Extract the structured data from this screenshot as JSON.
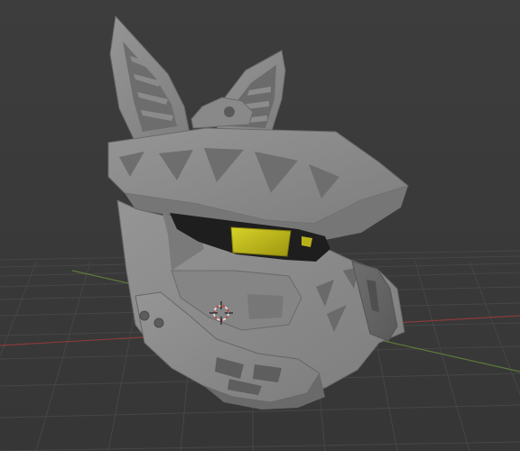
{
  "viewport": {
    "background": "#3b3b3b",
    "grid_color": "#464646",
    "x_axis_color": "#8a3a3a",
    "y_axis_color": "#5d7a3a",
    "model_color": "#8f8f8f",
    "visor_color": "#c8c21a"
  },
  "icons": {
    "origin_cursor": "3d-cursor-icon"
  }
}
